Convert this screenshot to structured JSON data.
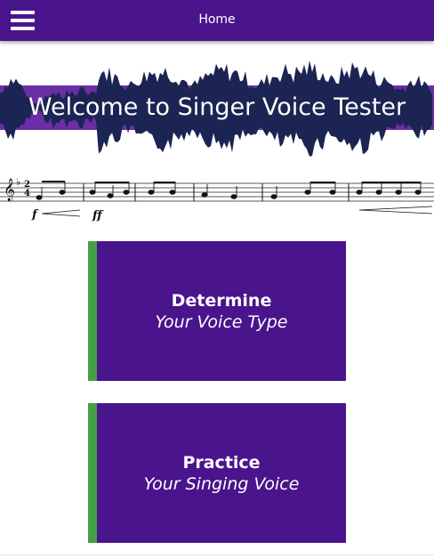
{
  "header": {
    "title": "Home",
    "menu_icon": "hamburger-menu-icon",
    "background": "#4a148c"
  },
  "banner": {
    "title": "Welcome to Singer Voice Tester",
    "band_color": "#6a2ea6",
    "wave_color": "#1b2452"
  },
  "staff": {
    "dynamics": [
      "f",
      "ff"
    ],
    "time_signature": [
      "2",
      "4"
    ]
  },
  "cards": [
    {
      "title": "Determine",
      "subtitle": "Your Voice Type"
    },
    {
      "title": "Practice",
      "subtitle": "Your Singing Voice"
    }
  ],
  "colors": {
    "card_bg": "#4a148c",
    "card_accent": "#43a047"
  }
}
